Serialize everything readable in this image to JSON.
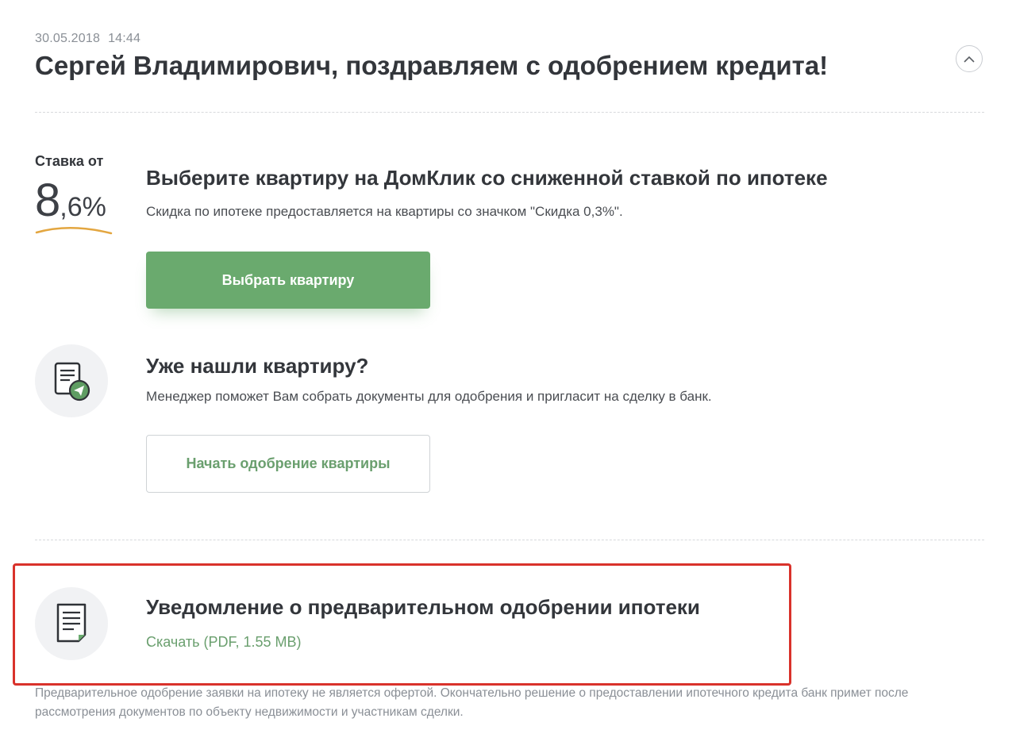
{
  "header": {
    "date": "30.05.2018",
    "time": "14:44",
    "title": "Сергей Владимирович, поздравляем с одобрением кредита!",
    "collapse_icon": "chevron-up-icon"
  },
  "rate": {
    "label": "Ставка от",
    "value_int": "8",
    "value_frac": ",6%"
  },
  "offer": {
    "title": "Выберите квартиру на ДомКлик со сниженной ставкой по ипотеке",
    "subtitle": "Скидка по ипотеке предоставляется на квартиры со значком \"Скидка 0,3%\".",
    "button_label": "Выбрать квартиру",
    "button_color": "#6aaa6e"
  },
  "found": {
    "icon": "document-send-icon",
    "title": "Уже нашли квартиру?",
    "subtitle": "Менеджер поможет Вам собрать документы для одобрения и пригласит на сделку в банк.",
    "button_label": "Начать одобрение квартиры"
  },
  "notice": {
    "icon": "document-icon",
    "title": "Уведомление о предварительном одобрении ипотеки",
    "download_label": "Скачать (PDF, 1.55 MB)",
    "highlight_color": "#d9322b"
  },
  "disclaimer": "Предварительное одобрение заявки на ипотеку не является офертой. Окончательно решение о предоставлении ипотечного кредита банк примет после рассмотрения документов по объекту недвижимости и участникам сделки.",
  "colors": {
    "accent_green": "#6aaa6e",
    "text_dark": "#33363b",
    "text_muted": "#8a8f96"
  }
}
